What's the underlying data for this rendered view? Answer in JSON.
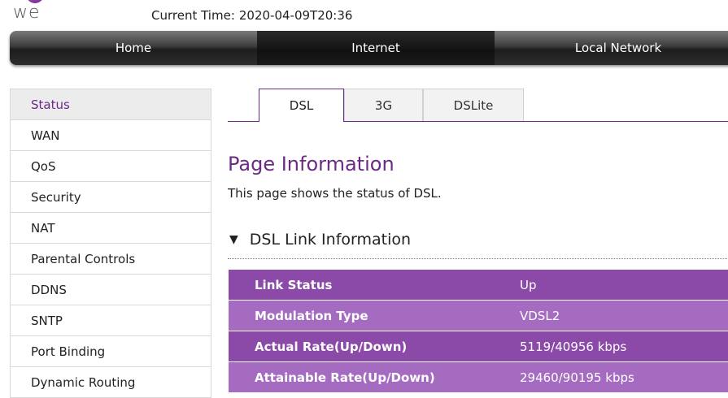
{
  "header": {
    "logo_text": "we",
    "current_time_label": "Current Time:",
    "current_time_value": "2020-04-09T20:36"
  },
  "topnav": {
    "tabs": [
      {
        "label": "Home"
      },
      {
        "label": "Internet",
        "active": true
      },
      {
        "label": "Local Network"
      }
    ]
  },
  "sidebar": {
    "items": [
      {
        "label": "Status",
        "active": true
      },
      {
        "label": "WAN"
      },
      {
        "label": "QoS"
      },
      {
        "label": "Security"
      },
      {
        "label": "NAT"
      },
      {
        "label": "Parental Controls"
      },
      {
        "label": "DDNS"
      },
      {
        "label": "SNTP"
      },
      {
        "label": "Port Binding"
      },
      {
        "label": "Dynamic Routing"
      }
    ]
  },
  "subtabs": [
    {
      "label": "DSL",
      "active": true
    },
    {
      "label": "3G"
    },
    {
      "label": "DSLite"
    }
  ],
  "page": {
    "title": "Page Information",
    "description": "This page shows the status of DSL."
  },
  "section": {
    "toggle_icon": "triangle-down-icon",
    "title": "DSL Link Information"
  },
  "dsl_info": [
    {
      "label": "Link Status",
      "value": "Up"
    },
    {
      "label": "Modulation Type",
      "value": "VDSL2"
    },
    {
      "label": "Actual Rate(Up/Down)",
      "value": "5119/40956 kbps"
    },
    {
      "label": "Attainable Rate(Up/Down)",
      "value": "29460/90195 kbps"
    }
  ],
  "colors": {
    "accent": "#6a2a85",
    "row_dark": "#8b4aa8",
    "row_light": "#a46bc1",
    "nav_dark": "#1d1d1d"
  }
}
